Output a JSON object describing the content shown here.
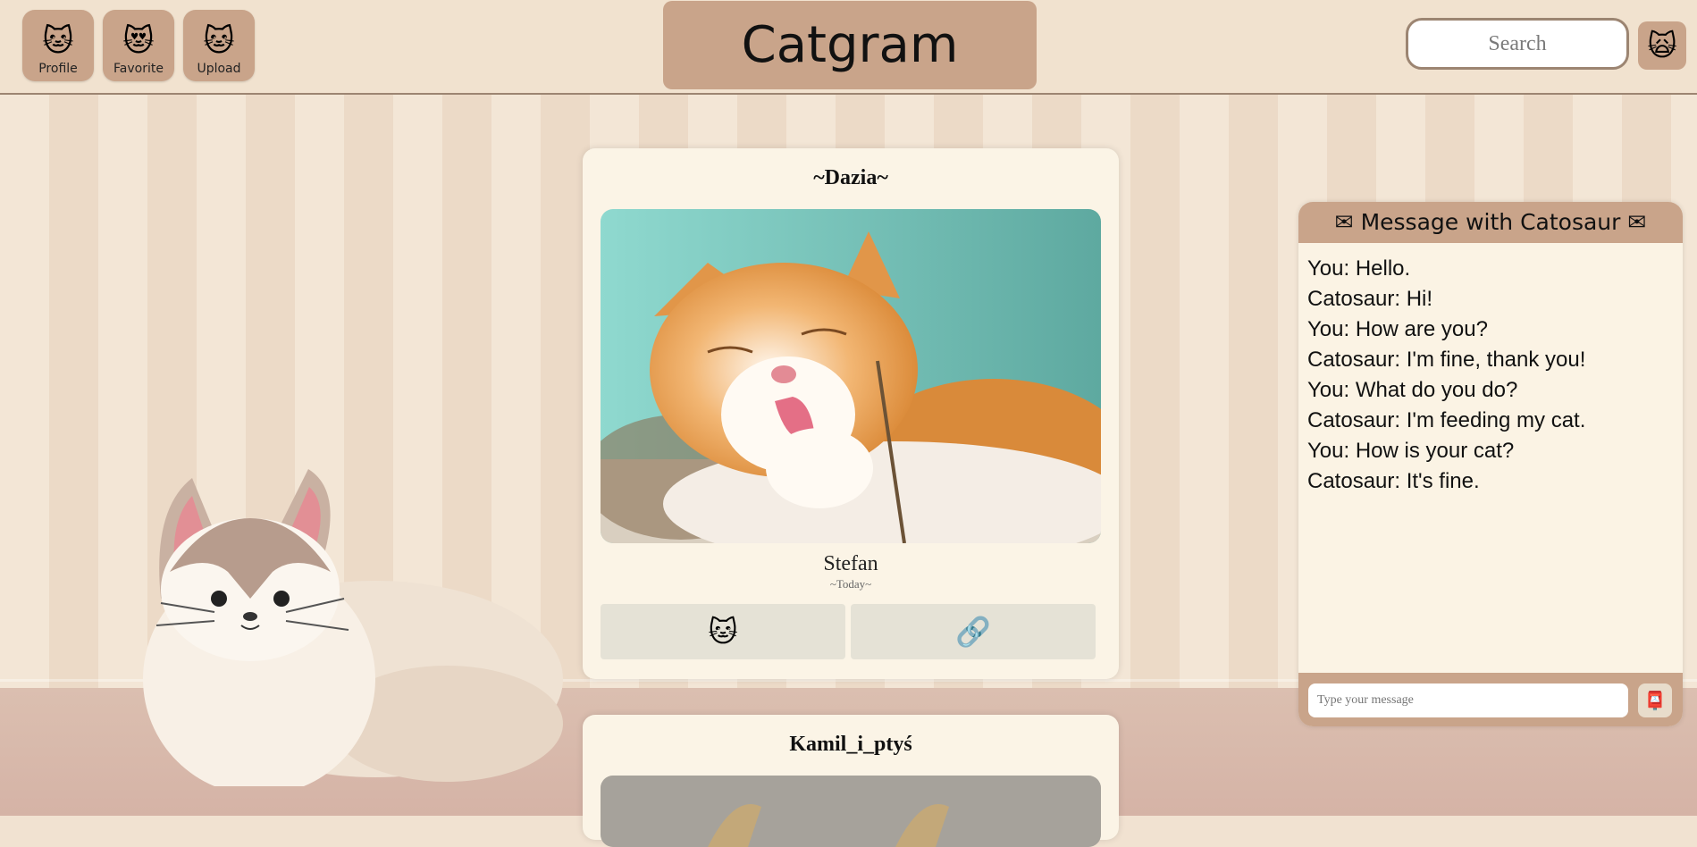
{
  "app": {
    "title": "Catgram"
  },
  "nav": [
    {
      "label": "Profile",
      "icon": "🐱"
    },
    {
      "label": "Favorite",
      "icon": "😻"
    },
    {
      "label": "Upload",
      "icon": "🐱"
    }
  ],
  "search": {
    "placeholder": "Search"
  },
  "profile_icon": "🙀",
  "posts": [
    {
      "author": "~Dazia~",
      "caption": "Stefan",
      "date": "~Today~",
      "like_icon": "🐱",
      "link_icon": "🔗"
    },
    {
      "author": "Kamil_i_ptyś"
    }
  ],
  "chat": {
    "title": "Message with Catosaur",
    "icon": "✉",
    "messages": [
      "You: Hello.",
      "Catosaur: Hi!",
      "You: How are you?",
      "Catosaur: I'm fine, thank you!",
      "You: What do you do?",
      "Catosaur: I'm feeding my cat.",
      "You: How is your cat?",
      "Catosaur: It's fine."
    ],
    "input_placeholder": "Type your message",
    "send_icon": "📮"
  }
}
